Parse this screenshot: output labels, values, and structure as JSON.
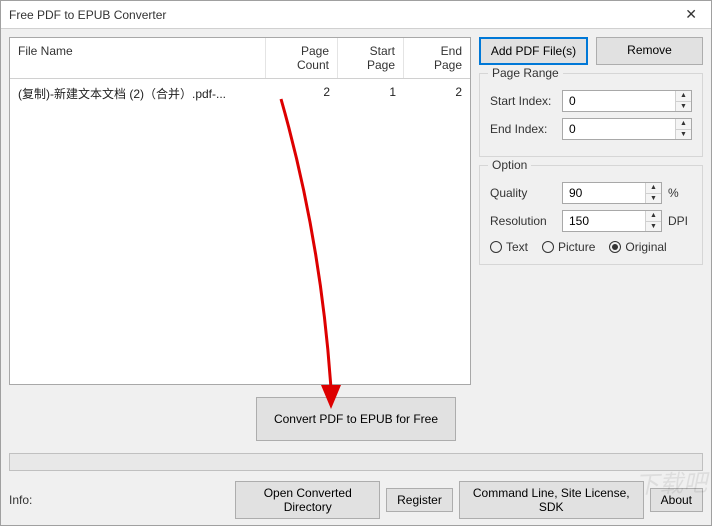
{
  "window": {
    "title": "Free PDF to EPUB Converter"
  },
  "table": {
    "headers": {
      "fileName": "File Name",
      "pageCount": "Page Count",
      "startPage": "Start Page",
      "endPage": "End Page"
    },
    "rows": [
      {
        "fileName": "(复制)-新建文本文档 (2)（合并）.pdf-...",
        "pageCount": "2",
        "startPage": "1",
        "endPage": "2"
      }
    ]
  },
  "buttons": {
    "addPdf": "Add PDF File(s)",
    "remove": "Remove",
    "convert": "Convert PDF to EPUB for Free",
    "openDir": "Open Converted Directory",
    "register": "Register",
    "cmdLine": "Command Line, Site License, SDK",
    "about": "About"
  },
  "pageRange": {
    "title": "Page Range",
    "startLabel": "Start Index:",
    "startVal": "0",
    "endLabel": "End Index:",
    "endVal": "0"
  },
  "option": {
    "title": "Option",
    "qualityLabel": "Quality",
    "qualityVal": "90",
    "qualitySuffix": "%",
    "resLabel": "Resolution",
    "resVal": "150",
    "resSuffix": "DPI",
    "radios": {
      "text": "Text",
      "picture": "Picture",
      "original": "Original",
      "selected": "original"
    }
  },
  "info": {
    "label": "Info:"
  },
  "watermark": "下载吧"
}
